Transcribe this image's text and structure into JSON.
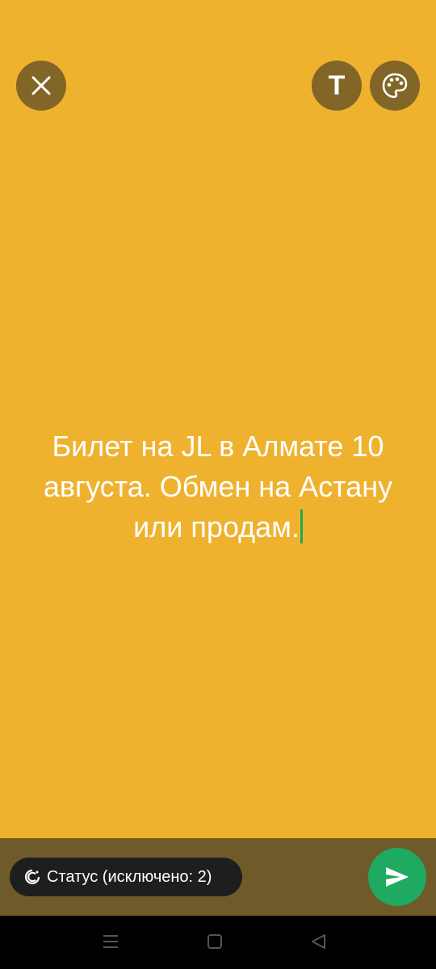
{
  "toolbar": {
    "text_button_label": "T"
  },
  "status": {
    "text": "Билет на JL в Алмате 10 августа. Обмен на Астану или продам."
  },
  "audience": {
    "label": "Статус (исключено: 2)"
  },
  "icons": {
    "close": "close-icon",
    "palette": "palette-icon",
    "audience": "status-privacy-icon",
    "send": "send-icon",
    "nav_menu": "menu-icon",
    "nav_home": "home-icon",
    "nav_back": "back-icon"
  },
  "colors": {
    "background": "#EFB22F",
    "button_bg": "#826628",
    "bottom_bar": "#6F5A29",
    "pill_bg": "#1D1F1F",
    "send": "#1EAA61",
    "cursor": "#1FA855"
  }
}
